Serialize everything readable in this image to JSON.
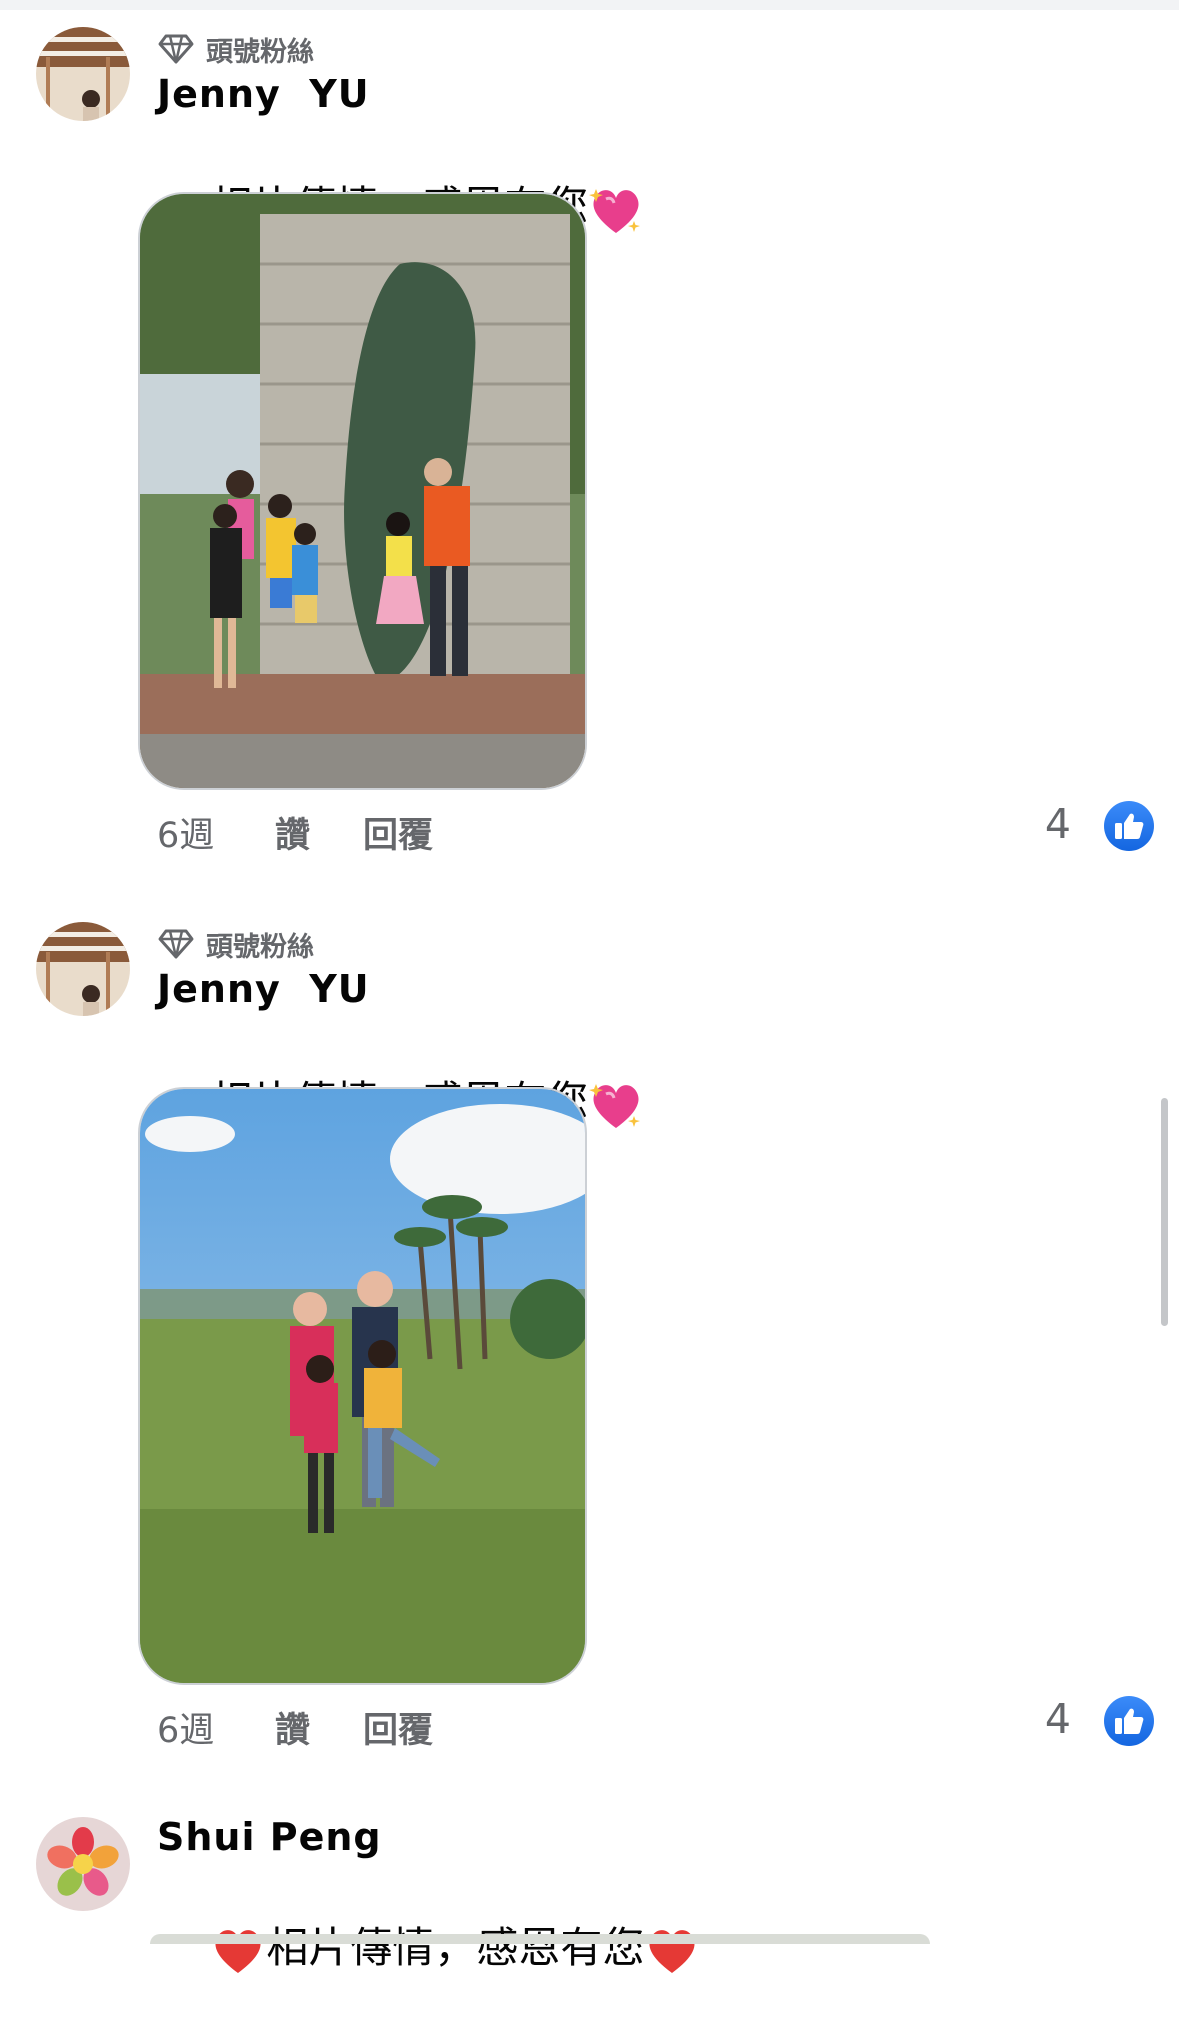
{
  "comments": [
    {
      "badge": "頭號粉絲",
      "author": "Jenny  YU",
      "text": "相片傳情，感恩有您",
      "emoji": "sparkling-heart",
      "time": "6週",
      "like_label": "讚",
      "reply_label": "回覆",
      "like_count": "4"
    },
    {
      "badge": "頭號粉絲",
      "author": "Jenny  YU",
      "text": "相片傳情，感恩有您",
      "emoji": "sparkling-heart",
      "time": "6週",
      "like_label": "讚",
      "reply_label": "回覆",
      "like_count": "4"
    },
    {
      "author": "Shui Peng",
      "text": "相片傳情，感恩有您",
      "emoji": "red-heart"
    }
  ],
  "colors": {
    "like_blue": "#1877f2",
    "secondary_text": "#65676b",
    "heart_pink": "#e83e8c",
    "heart_red": "#e53935"
  }
}
